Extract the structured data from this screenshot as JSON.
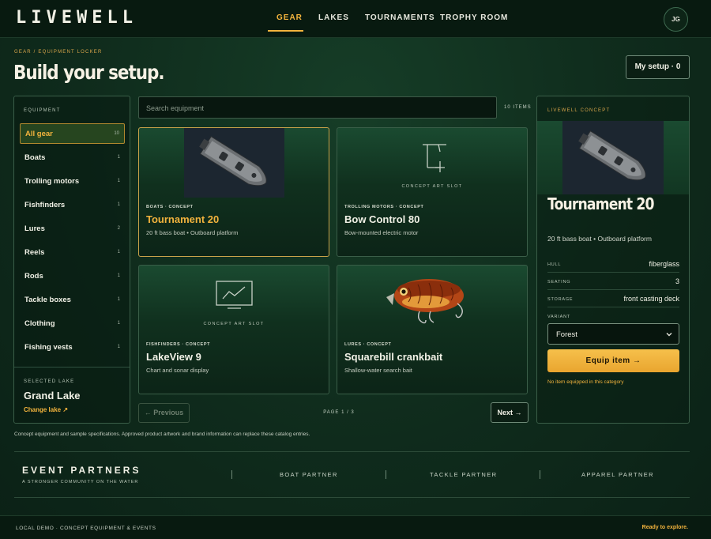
{
  "header": {
    "logo": "LIVEWELL",
    "nav": [
      {
        "label": "GEAR",
        "active": true
      },
      {
        "label": "LAKES",
        "active": false
      },
      {
        "label": "TOURNAMENTS",
        "active": false
      },
      {
        "label": "TROPHY ROOM",
        "active": false
      }
    ],
    "avatar_initials": "JG"
  },
  "breadcrumb": "GEAR / EQUIPMENT LOCKER",
  "page_title": "Build your setup.",
  "my_setup_label": "My setup · 0",
  "sidebar": {
    "heading": "EQUIPMENT",
    "items": [
      {
        "label": "All gear",
        "count": "10",
        "active": true
      },
      {
        "label": "Boats",
        "count": "1"
      },
      {
        "label": "Trolling motors",
        "count": "1"
      },
      {
        "label": "Fishfinders",
        "count": "1"
      },
      {
        "label": "Lures",
        "count": "2"
      },
      {
        "label": "Reels",
        "count": "1"
      },
      {
        "label": "Rods",
        "count": "1"
      },
      {
        "label": "Tackle boxes",
        "count": "1"
      },
      {
        "label": "Clothing",
        "count": "1"
      },
      {
        "label": "Fishing vests",
        "count": "1"
      }
    ],
    "selected_lake_heading": "SELECTED LAKE",
    "selected_lake": "Grand Lake",
    "change_lake": "Change lake ↗"
  },
  "search": {
    "placeholder": "Search equipment",
    "count": "10 ITEMS"
  },
  "cards": [
    {
      "category": "BOATS · CONCEPT",
      "title": "Tournament 20",
      "subtitle": "20 ft bass boat • Outboard platform",
      "image": "boat-image",
      "selected": true
    },
    {
      "category": "TROLLING MOTORS · CONCEPT",
      "title": "Bow Control 80",
      "subtitle": "Bow-mounted electric motor",
      "image": "trolling-motor-icon",
      "slot_label": "CONCEPT ART SLOT"
    },
    {
      "category": "FISHFINDERS · CONCEPT",
      "title": "LakeView 9",
      "subtitle": "Chart and sonar display",
      "image": "sonar-display-icon",
      "slot_label": "CONCEPT ART SLOT"
    },
    {
      "category": "LURES · CONCEPT",
      "title": "Squarebill crankbait",
      "subtitle": "Shallow-water search bait",
      "image": "crankbait-image"
    }
  ],
  "pagination": {
    "prev": "← Previous",
    "page": "PAGE 1 / 3",
    "next": "Next →"
  },
  "detail": {
    "eyebrow": "LIVEWELL CONCEPT",
    "title": "Tournament 20",
    "subtitle": "20 ft bass boat • Outboard platform",
    "specs": [
      {
        "key": "HULL",
        "value": "fiberglass"
      },
      {
        "key": "SEATING",
        "value": "3"
      },
      {
        "key": "STORAGE",
        "value": "front casting deck"
      }
    ],
    "variant_heading": "VARIANT",
    "variant_value": "Forest",
    "equip_button": "Equip item →",
    "equip_note": "No item equipped in this category"
  },
  "disclaimer": "Concept equipment and sample specifications. Approved product artwork and brand information can replace these catalog entries.",
  "partners": {
    "title": "EVENT PARTNERS",
    "subtitle": "A STRONGER COMMUNITY ON THE WATER",
    "items": [
      "BOAT PARTNER",
      "TACKLE PARTNER",
      "APPAREL PARTNER"
    ]
  },
  "footer": {
    "left": "LOCAL DEMO · CONCEPT EQUIPMENT & EVENTS",
    "right": "Ready to explore."
  },
  "colors": {
    "accent": "#f2b33d",
    "background": "#0f2b1c",
    "panel_border": "#3a5e48"
  }
}
